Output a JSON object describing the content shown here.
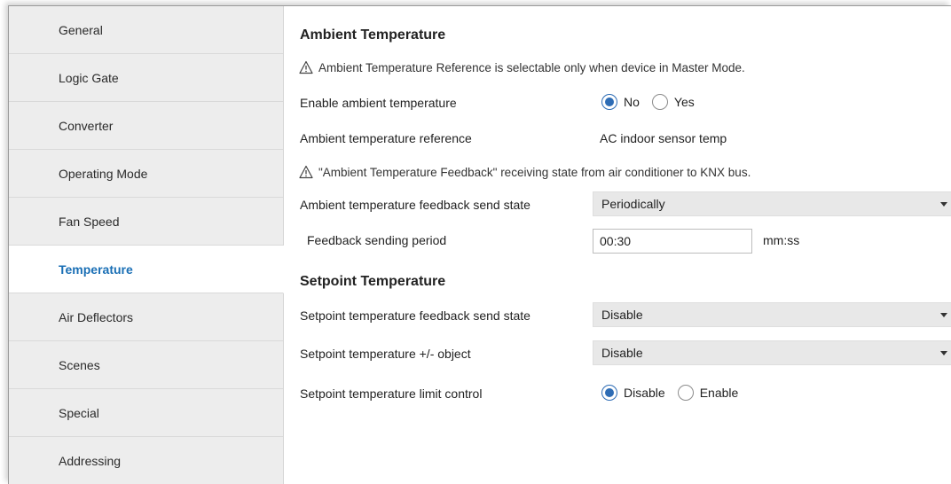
{
  "sidebar": {
    "items": [
      {
        "label": "General"
      },
      {
        "label": "Logic Gate"
      },
      {
        "label": "Converter"
      },
      {
        "label": "Operating Mode"
      },
      {
        "label": "Fan Speed"
      },
      {
        "label": "Temperature"
      },
      {
        "label": "Air Deflectors"
      },
      {
        "label": "Scenes"
      },
      {
        "label": "Special"
      },
      {
        "label": "Addressing"
      }
    ],
    "active": "Temperature"
  },
  "ambient": {
    "title": "Ambient Temperature",
    "note1": "Ambient Temperature Reference is selectable only when device in Master Mode.",
    "enable_label": "Enable ambient temperature",
    "enable_options": [
      "No",
      "Yes"
    ],
    "enable_selected": "No",
    "reference_label": "Ambient temperature reference",
    "reference_value": "AC indoor sensor temp",
    "note2": "\"Ambient Temperature Feedback\" receiving state from air conditioner to KNX bus.",
    "feedback_label": "Ambient temperature feedback send state",
    "feedback_value": "Periodically",
    "period_label": "Feedback sending period",
    "period_value": "00:30",
    "period_unit": "mm:ss"
  },
  "setpoint": {
    "title": "Setpoint Temperature",
    "feedback_label": "Setpoint temperature feedback send state",
    "feedback_value": "Disable",
    "object_label": "Setpoint temperature +/- object",
    "object_value": "Disable",
    "limit_label": "Setpoint temperature limit control",
    "limit_options": [
      "Disable",
      "Enable"
    ],
    "limit_selected": "Disable"
  },
  "colors": {
    "accent": "#1a6fb5",
    "radio_selected": "#2d6cb5",
    "sidebar_bg": "#ededed",
    "select_bg": "#e8e8e8"
  },
  "icons": {
    "warning": "warning-triangle-icon",
    "dropdown": "chevron-down-icon"
  }
}
